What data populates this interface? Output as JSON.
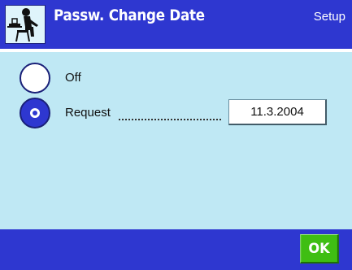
{
  "header": {
    "title": "Passw. Change Date",
    "mode": "Setup",
    "icon": "operator-at-balance-icon"
  },
  "options": [
    {
      "label": "Off",
      "selected": false
    },
    {
      "label": "Request",
      "selected": true
    }
  ],
  "request_date": "11.3.2004",
  "footer": {
    "ok_label": "OK"
  },
  "colors": {
    "header_bg": "#2e37d0",
    "content_bg": "#bfe8f4",
    "ok_bg": "#3fbe13"
  }
}
